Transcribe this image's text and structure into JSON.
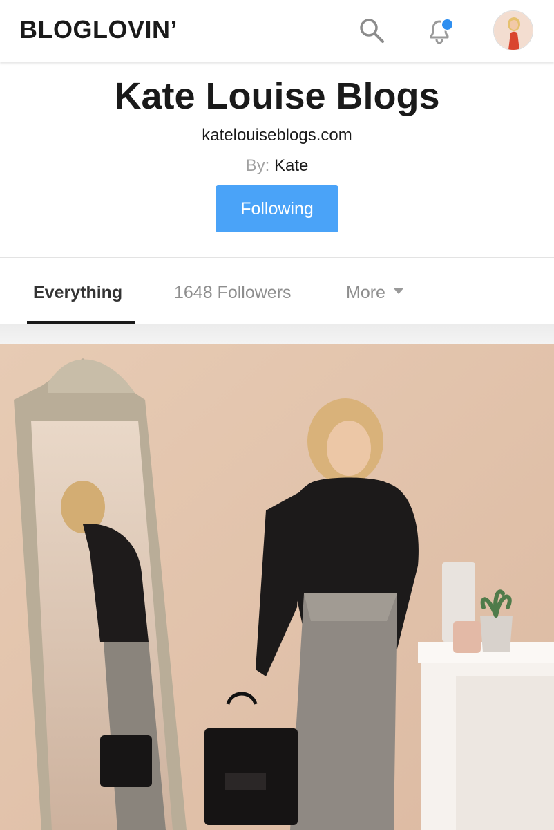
{
  "header": {
    "logo": "BLOGLOVIN’",
    "search_icon": "search-icon",
    "bell_icon": "bell-icon",
    "notification_color": "#2f8ff0",
    "avatar_icon": "avatar"
  },
  "profile": {
    "title": "Kate Louise Blogs",
    "url": "katelouiseblogs.com",
    "by_label": "By:",
    "author": "Kate",
    "follow_button": "Following",
    "accent_color": "#4aa3f8"
  },
  "tabs": [
    {
      "label": "Everything",
      "active": true
    },
    {
      "label": "1648 Followers",
      "active": false
    },
    {
      "label": "More",
      "active": false
    }
  ],
  "feed": {
    "photo_icon": "post-photo"
  }
}
